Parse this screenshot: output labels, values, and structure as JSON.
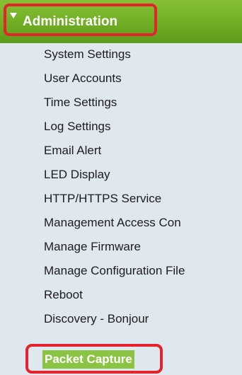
{
  "section": {
    "title": "Administration",
    "expand_icon": "triangle-down-icon"
  },
  "menu": {
    "items": [
      {
        "label": "System Settings"
      },
      {
        "label": "User Accounts"
      },
      {
        "label": "Time Settings"
      },
      {
        "label": "Log Settings"
      },
      {
        "label": "Email Alert"
      },
      {
        "label": "LED Display"
      },
      {
        "label": "HTTP/HTTPS Service"
      },
      {
        "label": "Management Access Con"
      },
      {
        "label": "Manage Firmware"
      },
      {
        "label": "Manage Configuration File"
      },
      {
        "label": "Reboot"
      },
      {
        "label": "Discovery - Bonjour"
      },
      {
        "label": "Packet Capture"
      }
    ],
    "selected_index": 12
  },
  "colors": {
    "header_green": "#6fae24",
    "menu_background": "#dfe8ef",
    "selected_green": "#8bc442",
    "highlight_red": "#e5232b"
  }
}
